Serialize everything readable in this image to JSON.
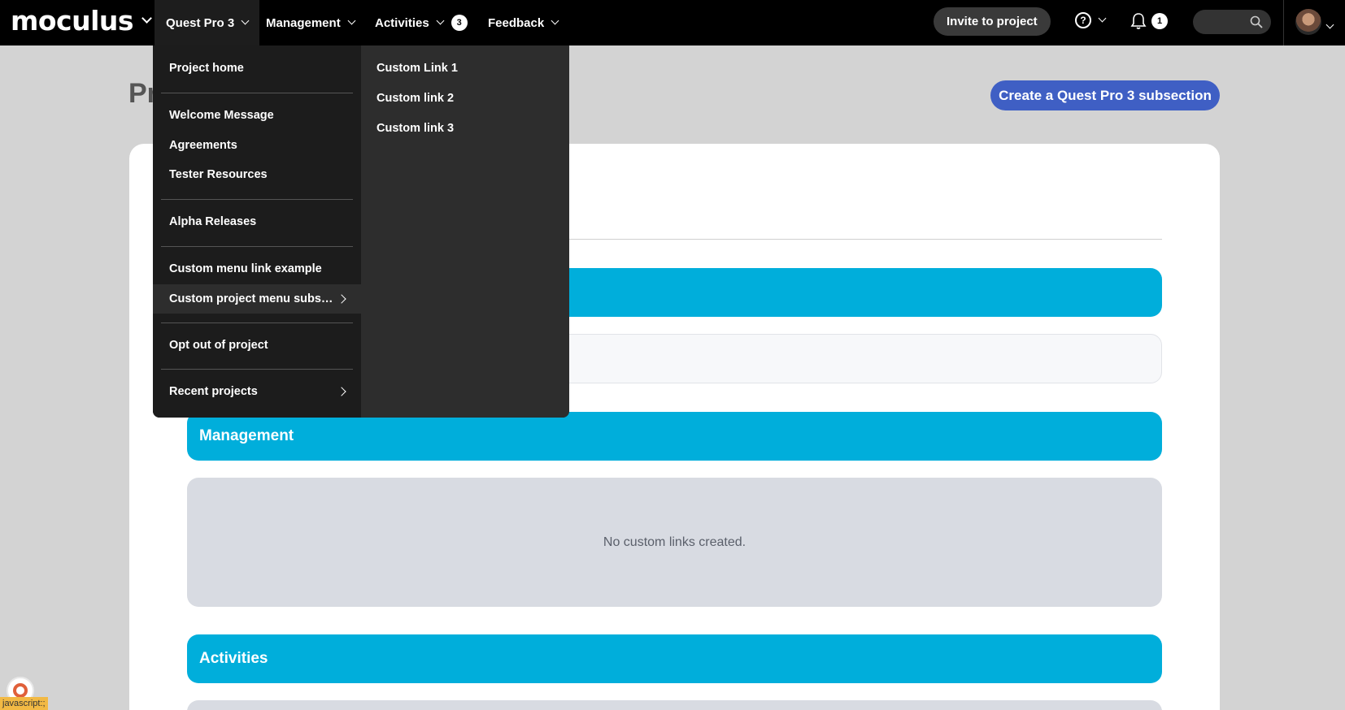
{
  "nav": {
    "logo": "moculus",
    "items": [
      {
        "label": "Quest Pro 3"
      },
      {
        "label": "Management"
      },
      {
        "label": "Activities",
        "badge": "3"
      },
      {
        "label": "Feedback"
      }
    ],
    "invite_label": "Invite to project",
    "help_glyph": "?",
    "notifications_count": "1"
  },
  "page": {
    "title": "Pr",
    "create_button": "Create a Quest Pro 3 subsection",
    "sections": [
      {
        "label": "Management"
      },
      {
        "label": "Activities"
      }
    ],
    "empty_text": "No custom links created."
  },
  "dropdown": {
    "left_items": [
      {
        "label": "Project home"
      },
      {
        "label": "Welcome Message"
      },
      {
        "label": "Agreements"
      },
      {
        "label": "Tester Resources"
      },
      {
        "label": "Alpha Releases"
      },
      {
        "label": "Custom menu link example"
      },
      {
        "label": "Custom project menu subsection"
      },
      {
        "label": "Opt out of project"
      },
      {
        "label": "Recent projects"
      }
    ],
    "right_items": [
      {
        "label": "Custom Link 1"
      },
      {
        "label": "Custom link 2"
      },
      {
        "label": "Custom link 3"
      }
    ]
  },
  "status_bar": "javascript:;",
  "colors": {
    "nav_bg": "#000000",
    "accent_cyan": "#00aedb",
    "button_blue": "#3f5fc4",
    "dropdown_bg": "#1c1c1c",
    "dropdown_hover": "#2d2d2d"
  }
}
